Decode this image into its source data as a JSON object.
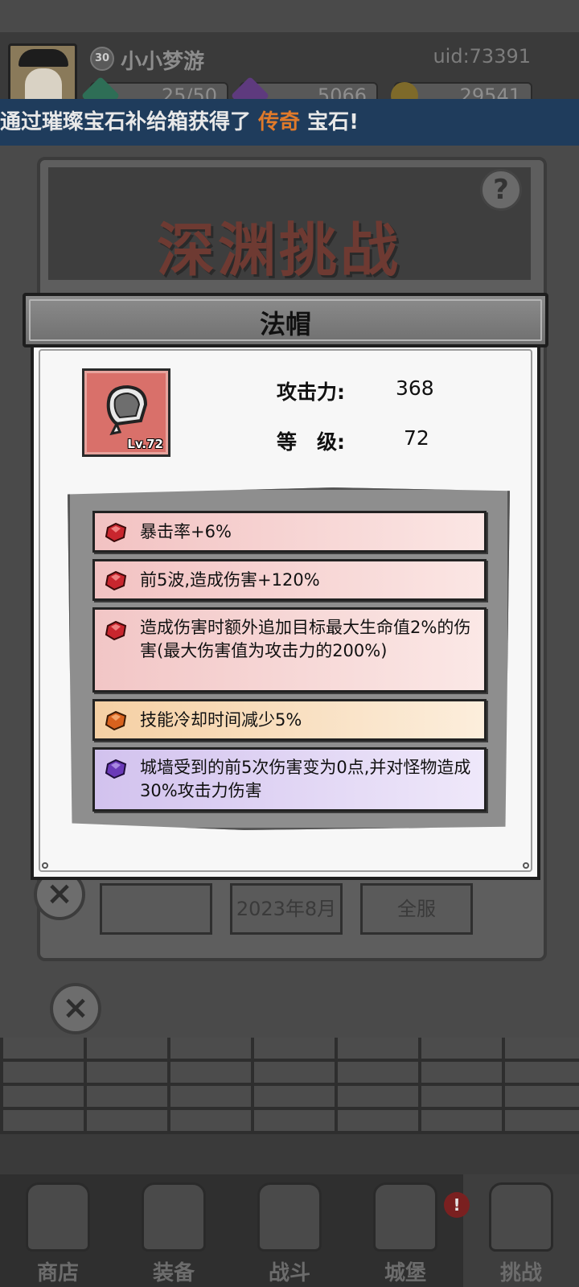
{
  "player": {
    "level": "30",
    "name": "小小梦游",
    "uid": "uid:73391",
    "resources": [
      {
        "icon": "stamina-gem-icon",
        "value": "25/50",
        "color": "#4ab08a"
      },
      {
        "icon": "purple-gem-icon",
        "value": "5066",
        "color": "#9a5ad0"
      },
      {
        "icon": "gold-coin-icon",
        "value": "29541",
        "color": "#d8a520"
      }
    ]
  },
  "ticker": {
    "prefix": "通过璀璨宝石补给箱获得了 ",
    "highlight": "传奇",
    "suffix": " 宝石!"
  },
  "screen": {
    "title": "深渊挑战",
    "help": "?",
    "row": [
      "",
      "2023年8月",
      "全服"
    ]
  },
  "nav": [
    "商店",
    "装备",
    "战斗",
    "城堡",
    "挑战"
  ],
  "nav_badge": "!",
  "modal": {
    "title": "法帽",
    "item_level": "Lv.72",
    "attack_label": "攻击力:",
    "attack_value": "368",
    "grade_label": "等　级:",
    "grade_value": "72",
    "attributes": [
      {
        "text": "暴击率+6%",
        "rarity": "red",
        "gem_color": "#c8262e",
        "bg": "#f5c9c9"
      },
      {
        "text": "前5波,造成伤害+120%",
        "rarity": "red",
        "gem_color": "#c8262e",
        "bg": "#f6cccb"
      },
      {
        "text": "造成伤害时额外追加目标最大生命值2%的伤害(最大伤害值为攻击力的200%)",
        "rarity": "red",
        "gem_color": "#c8262e",
        "bg": "#f7d0ce"
      },
      {
        "text": "技能冷却时间减少5%",
        "rarity": "orange",
        "gem_color": "#d8621e",
        "bg": "#f7d9b4"
      },
      {
        "text": "城墙受到的前5次伤害变为0点,并对怪物造成30%攻击力伤害",
        "rarity": "purple",
        "gem_color": "#6a3ab8",
        "bg": "#d9cdf0"
      }
    ]
  }
}
